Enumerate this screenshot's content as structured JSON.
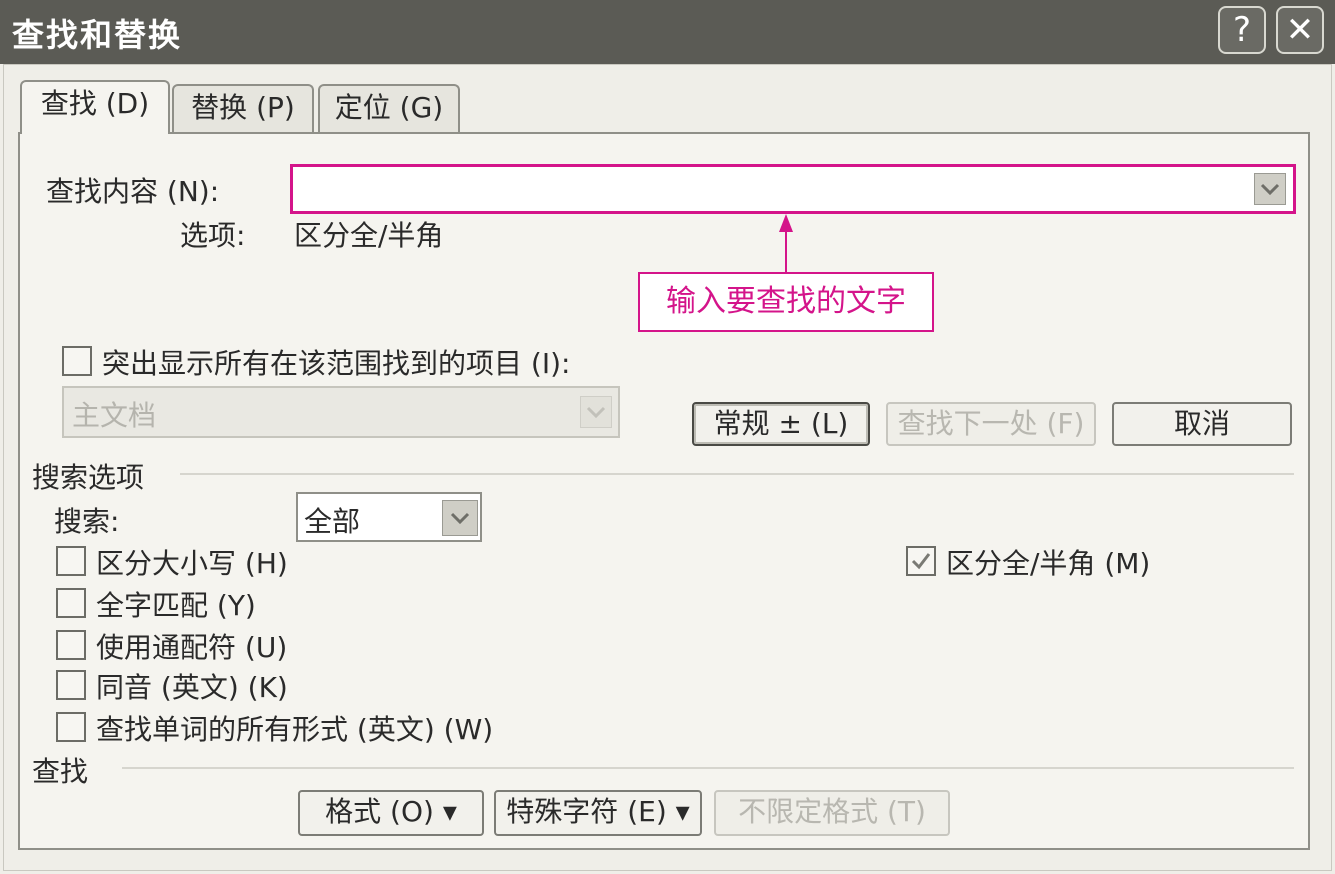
{
  "window": {
    "title": "查找和替换",
    "help_label": "?",
    "close_label": "✕"
  },
  "tabs": [
    {
      "label": "查找 (D)",
      "active": true
    },
    {
      "label": "替换 (P)",
      "active": false
    },
    {
      "label": "定位 (G)",
      "active": false
    }
  ],
  "find": {
    "label": "查找内容 (N):",
    "value": "",
    "options_label": "选项:",
    "options_value": "区分全/半角"
  },
  "annotation": {
    "text": "输入要查找的文字",
    "color": "#d4148a"
  },
  "highlight": {
    "label": "突出显示所有在该范围找到的项目 (I):",
    "checked": false,
    "scope_value": "主文档"
  },
  "buttons": {
    "normal": "常规 ± (L)",
    "find_next": "查找下一处 (F)",
    "cancel": "取消"
  },
  "search_options": {
    "group_title": "搜索选项",
    "search_label": "搜索:",
    "search_value": "全部",
    "checkboxes_left": [
      {
        "label": "区分大小写 (H)",
        "checked": false
      },
      {
        "label": "全字匹配 (Y)",
        "checked": false
      },
      {
        "label": "使用通配符 (U)",
        "checked": false
      },
      {
        "label": "同音 (英文) (K)",
        "checked": false
      },
      {
        "label": "查找单词的所有形式 (英文) (W)",
        "checked": false
      }
    ],
    "checkbox_right": {
      "label": "区分全/半角 (M)",
      "checked": true
    }
  },
  "find_group": {
    "title": "查找",
    "format_label": "格式 (O) ▾",
    "special_label": "特殊字符 (E) ▾",
    "no_format_label": "不限定格式 (T)"
  }
}
